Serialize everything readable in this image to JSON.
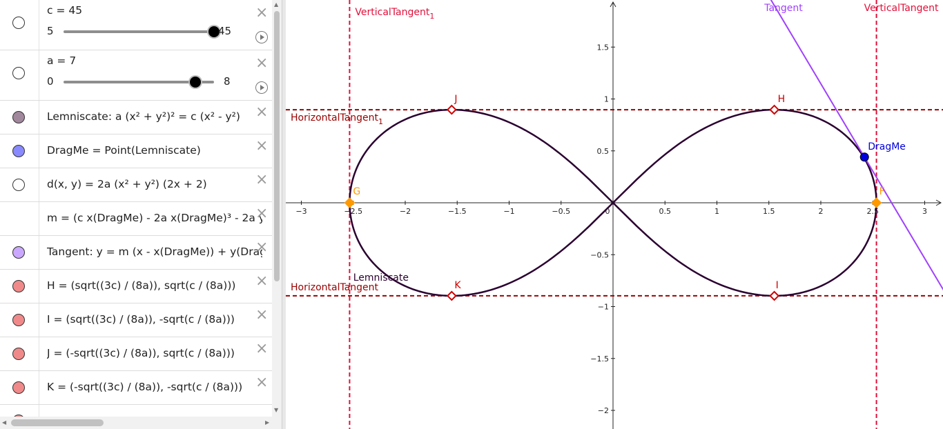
{
  "algebra": {
    "slider_c": {
      "label": "c = 45",
      "min": "5",
      "max": "45",
      "value": 45,
      "min_value": 5,
      "max_value": 45
    },
    "slider_a": {
      "label": "a = 7",
      "min": "0",
      "max": "8",
      "value": 7,
      "min_value": 0,
      "max_value": 8
    },
    "rows": [
      {
        "text": "Lemniscate: a (x² + y²)² = c (x² - y²)",
        "marble": "#a2889c"
      },
      {
        "text": "DragMe = Point(Lemniscate)",
        "marble": "#8a8aff"
      },
      {
        "text": "d(x, y) = 2a (x² + y²) (2x + 2)",
        "marble": "#ffffff"
      },
      {
        "text": "m = (c x(DragMe) - 2a x(DragMe)³ - 2a y",
        "marble": ""
      },
      {
        "text": "Tangent: y = m (x - x(DragMe)) + y(DragMe)",
        "marble": "#caa8ff"
      },
      {
        "text": "H = (sqrt((3c) / (8a)), sqrt(c / (8a)))",
        "marble": "#f08a8a"
      },
      {
        "text": "I = (sqrt((3c) / (8a)), -sqrt(c / (8a)))",
        "marble": "#f08a8a"
      },
      {
        "text": "J = (-sqrt((3c) / (8a)), sqrt(c / (8a)))",
        "marble": "#f08a8a"
      },
      {
        "text": "K = (-sqrt((3c) / (8a)), -sqrt(c / (8a)))",
        "marble": "#f08a8a"
      }
    ],
    "close_glyph": "×"
  },
  "graphics": {
    "x_ticks": [
      "−3",
      "−2.5",
      "−2",
      "−1.5",
      "−1",
      "−0.5",
      "0",
      "0.5",
      "1",
      "1.5",
      "2",
      "2.5",
      "3"
    ],
    "x_tick_values": [
      -3,
      -2.5,
      -2,
      -1.5,
      -1,
      -0.5,
      0,
      0.5,
      1,
      1.5,
      2,
      2.5,
      3
    ],
    "y_ticks": [
      "1.5",
      "1",
      "0.5",
      "−0.5",
      "−1",
      "−1.5",
      "−2"
    ],
    "y_tick_values": [
      1.5,
      1,
      0.5,
      -0.5,
      -1,
      -1.5,
      -2
    ],
    "x_range": [
      -3.3,
      3.2
    ],
    "y_range": [
      -2.1,
      1.95
    ],
    "labels": {
      "vertical_tangent_1": "VerticalTangent",
      "vertical_tangent_1_sub": "1",
      "vertical_tangent": "VerticalTangent",
      "horizontal_tangent_1": "HorizontalTangent",
      "horizontal_tangent_1_sub": "1",
      "horizontal_tangent": "HorizontalTangent",
      "tangent": "Tangent",
      "lemniscate": "Lemniscate",
      "dragme": "DragMe",
      "H": "H",
      "I": "I",
      "J": "J",
      "K": "K",
      "G": "G",
      "F": "F"
    },
    "params": {
      "a": 7,
      "c": 45,
      "dragme_x": 2.42,
      "dragme_y": 0.44
    },
    "colors": {
      "curve": "#2a0030",
      "vertical": "#e0103a",
      "horizontal": "#9a0000",
      "tangent": "#a040ff",
      "red_point": "#cc0000",
      "orange_point": "#ff9900",
      "drag_point": "#0000dd"
    }
  }
}
